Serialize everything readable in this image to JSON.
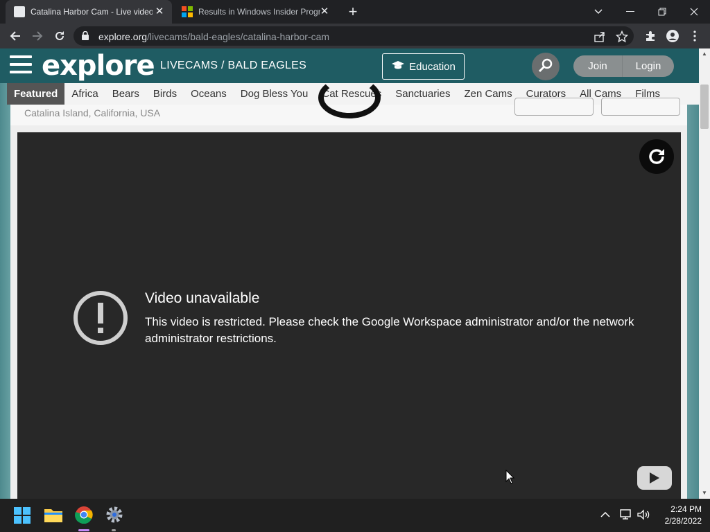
{
  "browser": {
    "tabs": [
      {
        "title": "Catalina Harbor Cam - Live video",
        "active": true
      },
      {
        "title": "Results in Windows Insider Progr",
        "active": false
      }
    ],
    "url_host": "explore.org",
    "url_path": "/livecams/bald-eagles/catalina-harbor-cam"
  },
  "site": {
    "logo_text": "explore",
    "breadcrumb": "LIVECAMS / BALD EAGLES",
    "education_label": "Education",
    "join_label": "Join",
    "login_label": "Login",
    "nav_items": [
      "Featured",
      "Africa",
      "Bears",
      "Birds",
      "Oceans",
      "Dog Bless You",
      "Cat Rescues",
      "Sanctuaries",
      "Zen Cams",
      "Curators",
      "All Cams",
      "Films"
    ],
    "location": "Catalina Island, California, USA"
  },
  "player": {
    "error_title": "Video unavailable",
    "error_message": "This video is restricted. Please check the Google Workspace administrator and/or the network administrator restrictions."
  },
  "taskbar": {
    "time": "2:24 PM",
    "date": "2/28/2022"
  },
  "colors": {
    "header_teal": "#1f5c63",
    "player_bg": "#282828",
    "chrome_dark": "#202124",
    "active_indicator": "#c58af9"
  }
}
